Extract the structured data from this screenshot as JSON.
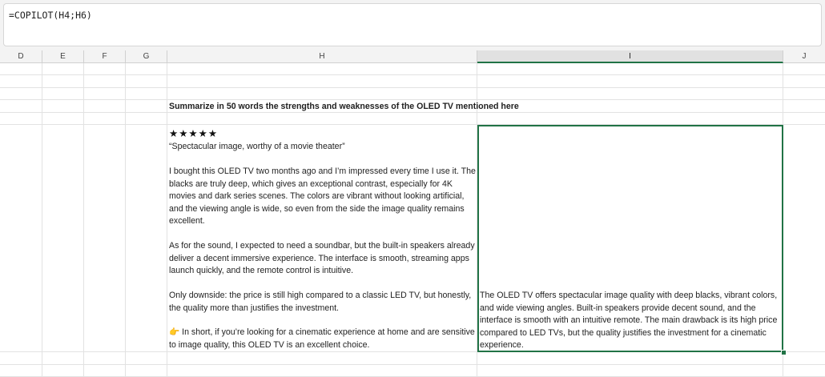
{
  "formula_bar": {
    "formula": "=COPILOT(H4;H6)"
  },
  "columns": [
    "D",
    "E",
    "F",
    "G",
    "H",
    "I",
    "J"
  ],
  "active_column": "I",
  "cells": {
    "H4": "Summarize in 50 words the strengths and weaknesses of the OLED TV mentioned here",
    "H6": {
      "stars": "★★★★★",
      "quote": "“Spectacular image, worthy of a movie theater”",
      "para1": "I bought this OLED TV two months ago and I’m impressed every time I use it. The blacks are truly deep, which gives an exceptional contrast, especially for 4K movies and dark series scenes. The colors are vibrant without looking artificial, and the viewing angle is wide, so even from the side the image quality remains excellent.",
      "para2": "As for the sound, I expected to need a soundbar, but the built-in speakers already deliver a decent immersive experience. The interface is smooth, streaming apps launch quickly, and the remote control is intuitive.",
      "para3": "Only downside: the price is still high compared to a classic LED TV, but honestly, the quality more than justifies the investment.",
      "para4": "👉 In short, if you’re looking for a cinematic experience at home and are sensitive to image quality, this OLED TV is an excellent choice."
    },
    "I6": "The OLED TV offers spectacular image quality with deep blacks, vibrant colors, and wide viewing angles. Built-in speakers provide decent sound, and the interface is smooth with an intuitive remote. The main drawback is its high price compared to LED TVs, but the quality justifies the investment for a cinematic experience."
  },
  "colors": {
    "selection": "#217346",
    "gridline": "#e2e2e2",
    "header_bg": "#f3f3f3"
  }
}
